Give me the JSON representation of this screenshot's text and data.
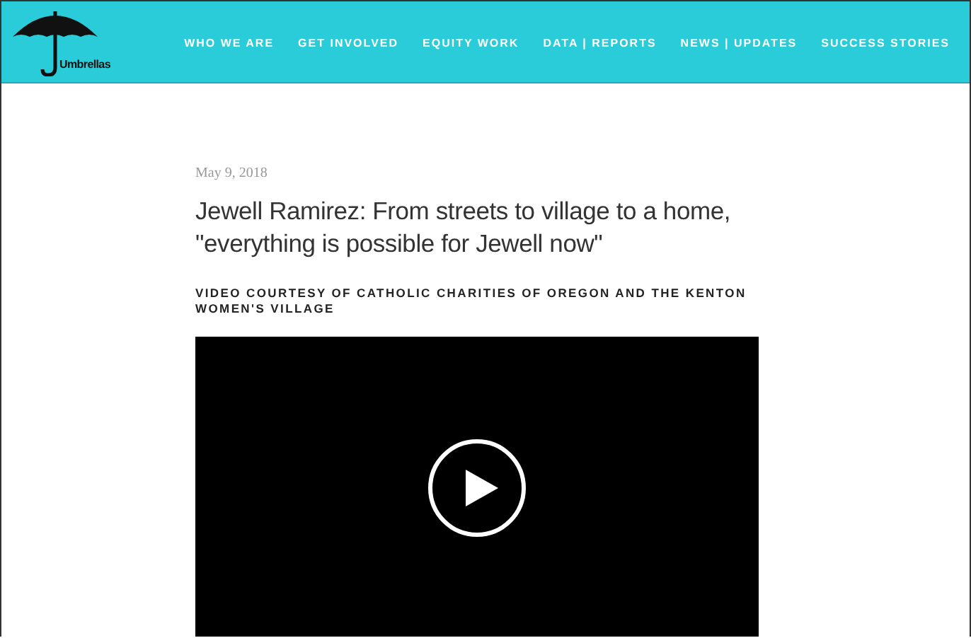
{
  "logo": {
    "wordmark": "Umbrellas"
  },
  "nav": [
    "WHO WE ARE",
    "GET INVOLVED",
    "EQUITY WORK",
    "DATA | REPORTS",
    "NEWS | UPDATES",
    "SUCCESS STORIES"
  ],
  "post": {
    "date": "May 9, 2018",
    "title": "Jewell Ramirez: From streets to village to a home, \"everything is possible for Jewell now\"",
    "caption": "VIDEO COURTESY OF CATHOLIC CHARITIES OF OREGON AND THE KENTON WOMEN'S VILLAGE"
  }
}
